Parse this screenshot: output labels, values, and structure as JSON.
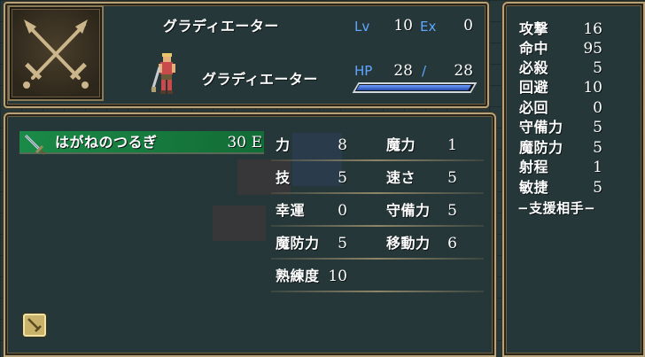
{
  "unit": {
    "class_name": "グラディエーター",
    "name": "グラディエーター",
    "lv_label": "Lv",
    "lv": "10",
    "ex_label": "Ex",
    "ex": "0",
    "hp_label": "HP",
    "hp_current": "28",
    "hp_sep": "/",
    "hp_max": "28",
    "hp_fraction": 1.0
  },
  "item": {
    "name": "はがねのつるぎ",
    "uses": "30",
    "equipped_mark": "E",
    "icon": "sword-icon"
  },
  "stats": {
    "str_label": "力",
    "str": "8",
    "mag_label": "魔力",
    "mag": "1",
    "skl_label": "技",
    "skl": "5",
    "spd_label": "速さ",
    "spd": "5",
    "lck_label": "幸運",
    "lck": "0",
    "def_label": "守備力",
    "def": "5",
    "res_label": "魔防力",
    "res": "5",
    "mov_label": "移動力",
    "mov": "6",
    "prof_label": "熟練度",
    "prof": "10"
  },
  "combat": {
    "atk_label": "攻撃",
    "atk": "16",
    "hit_label": "命中",
    "hit": "95",
    "crit_label": "必殺",
    "crit": "5",
    "avo_label": "回避",
    "avo": "10",
    "ddg_label": "必回",
    "ddg": "0",
    "def_label": "守備力",
    "def": "5",
    "res_label": "魔防力",
    "res": "5",
    "rng_label": "射程",
    "rng": "1",
    "agi_label": "敏捷",
    "agi": "5",
    "support_label": "−支援相手−"
  },
  "colors": {
    "label_blue": "#5fa7ff",
    "hp_bar": "#3f6fe0",
    "item_highlight": "#1b8a48",
    "frame_gold": "#b7a27a"
  }
}
